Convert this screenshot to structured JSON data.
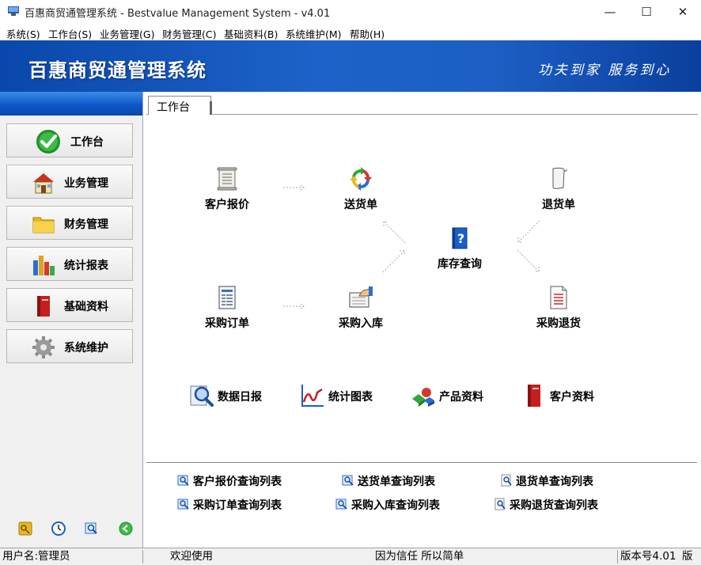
{
  "window": {
    "title": "百惠商贸通管理系统 - Bestvalue Management System - v4.01",
    "min_glyph": "—",
    "max_glyph": "☐",
    "close_glyph": "✕"
  },
  "menu": [
    "系统(S)",
    "工作台(S)",
    "业务管理(G)",
    "财务管理(C)",
    "基础资料(B)",
    "系统维护(M)",
    "帮助(H)"
  ],
  "banner": {
    "title": "百惠商贸通管理系统",
    "slogan": "功夫到家 服务到心"
  },
  "sidebar": {
    "items": [
      {
        "label": "工作台",
        "icon": "check-icon"
      },
      {
        "label": "业务管理",
        "icon": "house-icon"
      },
      {
        "label": "财务管理",
        "icon": "folder-icon"
      },
      {
        "label": "统计报表",
        "icon": "bar-chart-icon"
      },
      {
        "label": "基础资料",
        "icon": "book-icon"
      },
      {
        "label": "系统维护",
        "icon": "gear-icon"
      }
    ],
    "tools": [
      "key-icon",
      "clock-icon",
      "search-icon",
      "back-icon"
    ]
  },
  "tabs": [
    {
      "label": "工作台"
    }
  ],
  "workflow": {
    "quote": "客户报价",
    "delivery": "送货单",
    "return": "退货单",
    "inventory": "库存查询",
    "purchase_order": "采购订单",
    "purchase_in": "采购入库",
    "purchase_return": "采购退货"
  },
  "quick_links": {
    "daily_report": "数据日报",
    "charts": "统计图表",
    "products": "产品资料",
    "customers": "客户资料"
  },
  "report_links": [
    "客户报价查询列表",
    "送货单查询列表",
    "退货单查询列表",
    "采购订单查询列表",
    "采购入库查询列表",
    "采购退货查询列表"
  ],
  "status": {
    "user": "用户名:管理员",
    "welcome": "欢迎使用",
    "motto": "因为信任 所以简单",
    "version": "版本号4.01",
    "extra": "版"
  },
  "colors": {
    "banner_blue": "#1d62c8",
    "sidebar_header_blue": "#0d58c8"
  }
}
